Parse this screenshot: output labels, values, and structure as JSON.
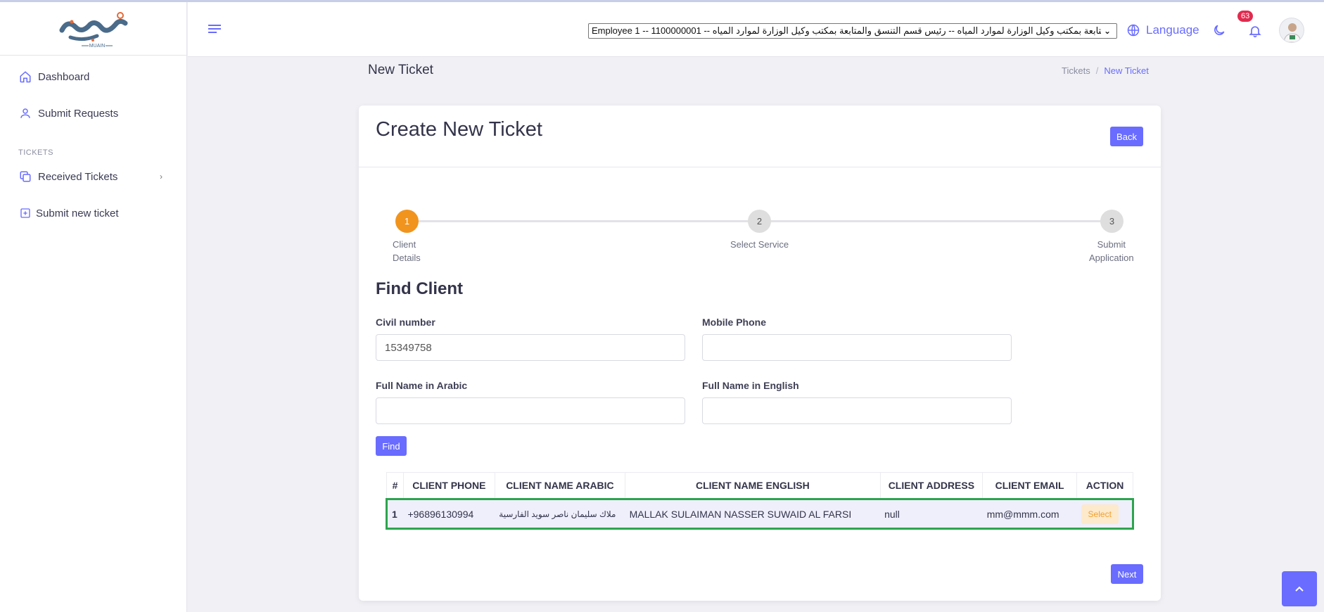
{
  "logo": {
    "text": "MUAIN"
  },
  "sidebar": {
    "items": [
      {
        "label": "Dashboard",
        "icon": "home-icon"
      },
      {
        "label": "Submit Requests",
        "icon": "user-icon"
      }
    ],
    "section_label": "TICKETS",
    "ticket_items": [
      {
        "label": "Received Tickets",
        "icon": "copy-icon"
      },
      {
        "label": "Submit new ticket",
        "icon": "plus-square-icon"
      }
    ]
  },
  "header": {
    "employee_select": "Employee 1 -- 1100000001 -- قسم التنسيق والمتابعة بمكتب وكيل الوزارة لموارد المياه -- رئيس قسم التنسق والمتابعة بمكتب وكيل الوزارة لموارد المياه",
    "language_label": "Language",
    "notification_count": "63"
  },
  "page": {
    "title": "New Ticket",
    "breadcrumb": [
      "Tickets",
      "New Ticket"
    ]
  },
  "card": {
    "title": "Create New Ticket",
    "back_label": "Back",
    "steps": [
      {
        "number": "1",
        "label_line1": "Client",
        "label_line2": "Details"
      },
      {
        "number": "2",
        "label_line1": "Select Service",
        "label_line2": ""
      },
      {
        "number": "3",
        "label_line1": "Submit",
        "label_line2": "Application"
      }
    ],
    "find_title": "Find Client",
    "fields": {
      "civil_number": {
        "label": "Civil number",
        "value": "15349758"
      },
      "mobile_phone": {
        "label": "Mobile Phone",
        "value": ""
      },
      "name_arabic": {
        "label": "Full Name in Arabic",
        "value": ""
      },
      "name_english": {
        "label": "Full Name in English",
        "value": ""
      }
    },
    "find_label": "Find",
    "table": {
      "headers": [
        "#",
        "CLIENT PHONE",
        "CLIENT NAME ARABIC",
        "CLIENT NAME ENGLISH",
        "CLIENT ADDRESS",
        "CLIENT EMAIL",
        "ACTION"
      ],
      "rows": [
        {
          "index": "1",
          "phone": "+96896130994",
          "name_arabic": "ملاك سليمان ناصر سويد الفارسية",
          "name_english": "MALLAK SULAIMAN NASSER SUWAID AL FARSI",
          "address": "null",
          "email": "mm@mmm.com",
          "action": "Select"
        }
      ]
    },
    "next_label": "Next"
  },
  "colors": {
    "accent": "#696cff",
    "step_active": "#f1941d",
    "row_highlight": "#2ea44f",
    "badge": "#e12b4e"
  }
}
